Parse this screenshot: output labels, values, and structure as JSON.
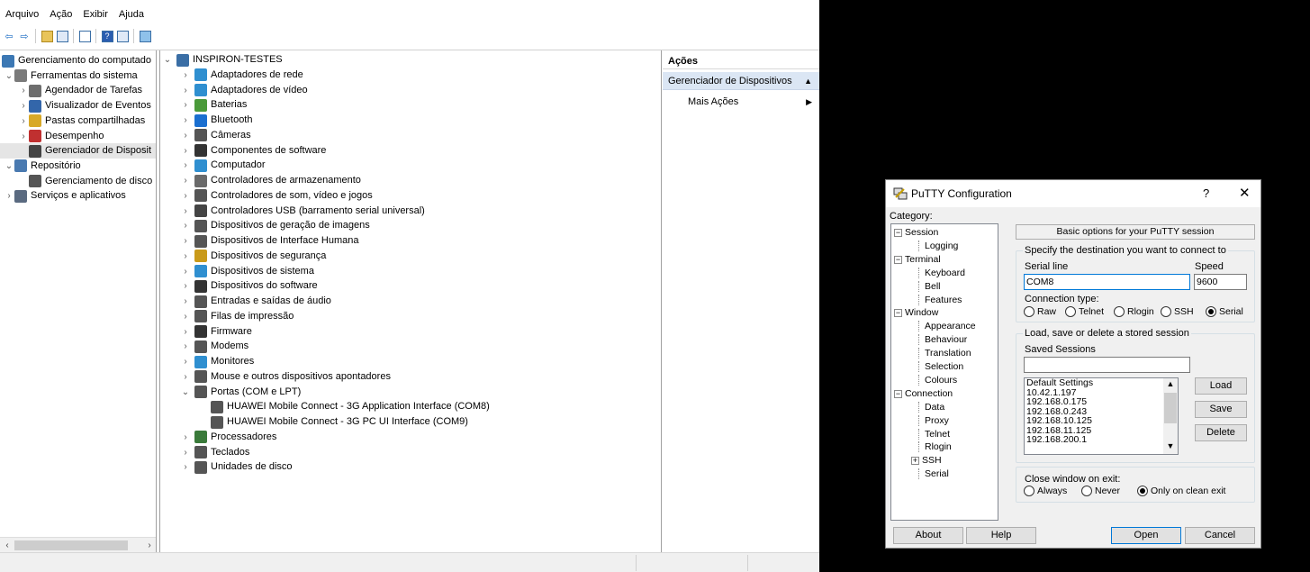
{
  "mmc": {
    "menu": [
      "Arquivo",
      "Ação",
      "Exibir",
      "Ajuda"
    ],
    "toolbar_icons": [
      "back-icon",
      "forward-icon",
      "folder-up-icon",
      "show-hide-tree-icon",
      "properties-icon",
      "help-icon",
      "action-pane-icon",
      "monitor-icon"
    ],
    "tree": [
      {
        "label": "Gerenciamento do computado",
        "indent": 0,
        "expander": "",
        "icon": "computer-management-icon",
        "color": "#3c78b4"
      },
      {
        "label": "Ferramentas do sistema",
        "indent": 1,
        "expander": "v",
        "icon": "tools-icon",
        "color": "#7a7a7a"
      },
      {
        "label": "Agendador de Tarefas",
        "indent": 2,
        "expander": ">",
        "icon": "clock-icon",
        "color": "#6e6e6e"
      },
      {
        "label": "Visualizador de Eventos",
        "indent": 2,
        "expander": ">",
        "icon": "event-viewer-icon",
        "color": "#3366aa"
      },
      {
        "label": "Pastas compartilhadas",
        "indent": 2,
        "expander": ">",
        "icon": "shared-folder-icon",
        "color": "#d8a928"
      },
      {
        "label": "Desempenho",
        "indent": 2,
        "expander": ">",
        "icon": "performance-icon",
        "color": "#c03030"
      },
      {
        "label": "Gerenciador de Disposit",
        "indent": 2,
        "expander": "",
        "icon": "device-manager-icon",
        "color": "#444444",
        "selected": true
      },
      {
        "label": "Repositório",
        "indent": 1,
        "expander": "v",
        "icon": "storage-icon",
        "color": "#4a7ab0"
      },
      {
        "label": "Gerenciamento de disco",
        "indent": 2,
        "expander": "",
        "icon": "disk-management-icon",
        "color": "#555555"
      },
      {
        "label": "Serviços e aplicativos",
        "indent": 1,
        "expander": ">",
        "icon": "services-icon",
        "color": "#5a6a80"
      }
    ],
    "devices": [
      {
        "label": "INSPIRON-TESTES",
        "level": 0,
        "expander": "v",
        "icon": "computer-icon",
        "color": "#3a6ea5"
      },
      {
        "label": "Adaptadores de rede",
        "level": 1,
        "expander": ">",
        "icon": "network-adapter-icon",
        "color": "#2f8fd0"
      },
      {
        "label": "Adaptadores de vídeo",
        "level": 1,
        "expander": ">",
        "icon": "display-adapter-icon",
        "color": "#2f8fd0"
      },
      {
        "label": "Baterias",
        "level": 1,
        "expander": ">",
        "icon": "battery-icon",
        "color": "#4a9a3a"
      },
      {
        "label": "Bluetooth",
        "level": 1,
        "expander": ">",
        "icon": "bluetooth-icon",
        "color": "#1a6fd0"
      },
      {
        "label": "Câmeras",
        "level": 1,
        "expander": ">",
        "icon": "camera-icon",
        "color": "#555555"
      },
      {
        "label": "Componentes de software",
        "level": 1,
        "expander": ">",
        "icon": "software-component-icon",
        "color": "#333333"
      },
      {
        "label": "Computador",
        "level": 1,
        "expander": ">",
        "icon": "monitor-icon",
        "color": "#2f8fd0"
      },
      {
        "label": "Controladores de armazenamento",
        "level": 1,
        "expander": ">",
        "icon": "storage-controller-icon",
        "color": "#6a6a6a"
      },
      {
        "label": "Controladores de som, vídeo e jogos",
        "level": 1,
        "expander": ">",
        "icon": "sound-icon",
        "color": "#555555"
      },
      {
        "label": "Controladores USB (barramento serial universal)",
        "level": 1,
        "expander": ">",
        "icon": "usb-icon",
        "color": "#444444"
      },
      {
        "label": "Dispositivos de geração de imagens",
        "level": 1,
        "expander": ">",
        "icon": "imaging-icon",
        "color": "#555555"
      },
      {
        "label": "Dispositivos de Interface Humana",
        "level": 1,
        "expander": ">",
        "icon": "hid-icon",
        "color": "#555555"
      },
      {
        "label": "Dispositivos de segurança",
        "level": 1,
        "expander": ">",
        "icon": "security-device-icon",
        "color": "#c99a1a"
      },
      {
        "label": "Dispositivos de sistema",
        "level": 1,
        "expander": ">",
        "icon": "system-device-icon",
        "color": "#2f8fd0"
      },
      {
        "label": "Dispositivos do software",
        "level": 1,
        "expander": ">",
        "icon": "software-device-icon",
        "color": "#333333"
      },
      {
        "label": "Entradas e saídas de áudio",
        "level": 1,
        "expander": ">",
        "icon": "audio-io-icon",
        "color": "#555555"
      },
      {
        "label": "Filas de impressão",
        "level": 1,
        "expander": ">",
        "icon": "printer-icon",
        "color": "#555555"
      },
      {
        "label": "Firmware",
        "level": 1,
        "expander": ">",
        "icon": "firmware-icon",
        "color": "#333333"
      },
      {
        "label": "Modems",
        "level": 1,
        "expander": ">",
        "icon": "modem-icon",
        "color": "#555555"
      },
      {
        "label": "Monitores",
        "level": 1,
        "expander": ">",
        "icon": "monitor-icon",
        "color": "#2f8fd0"
      },
      {
        "label": "Mouse e outros dispositivos apontadores",
        "level": 1,
        "expander": ">",
        "icon": "mouse-icon",
        "color": "#555555"
      },
      {
        "label": "Portas (COM e LPT)",
        "level": 1,
        "expander": "v",
        "icon": "port-icon",
        "color": "#555555"
      },
      {
        "label": "HUAWEI Mobile Connect - 3G Application Interface (COM8)",
        "level": 2,
        "expander": "",
        "icon": "port-icon",
        "color": "#555555"
      },
      {
        "label": "HUAWEI Mobile Connect - 3G PC UI Interface (COM9)",
        "level": 2,
        "expander": "",
        "icon": "port-icon",
        "color": "#555555"
      },
      {
        "label": "Processadores",
        "level": 1,
        "expander": ">",
        "icon": "processor-icon",
        "color": "#3a7a3a"
      },
      {
        "label": "Teclados",
        "level": 1,
        "expander": ">",
        "icon": "keyboard-icon",
        "color": "#555555"
      },
      {
        "label": "Unidades de disco",
        "level": 1,
        "expander": ">",
        "icon": "disk-drive-icon",
        "color": "#555555"
      }
    ],
    "actions": {
      "header": "Ações",
      "selected": "Gerenciador de Dispositivos",
      "more": "Mais Ações"
    }
  },
  "putty": {
    "title": "PuTTY Configuration",
    "help_glyph": "?",
    "close_glyph": "✕",
    "category_label": "Category:",
    "categories": [
      {
        "label": "Session",
        "kind": "group"
      },
      {
        "label": "Logging",
        "kind": "leaf"
      },
      {
        "label": "Terminal",
        "kind": "group"
      },
      {
        "label": "Keyboard",
        "kind": "leaf"
      },
      {
        "label": "Bell",
        "kind": "leaf"
      },
      {
        "label": "Features",
        "kind": "leaf"
      },
      {
        "label": "Window",
        "kind": "group"
      },
      {
        "label": "Appearance",
        "kind": "leaf"
      },
      {
        "label": "Behaviour",
        "kind": "leaf"
      },
      {
        "label": "Translation",
        "kind": "leaf"
      },
      {
        "label": "Selection",
        "kind": "leaf"
      },
      {
        "label": "Colours",
        "kind": "leaf"
      },
      {
        "label": "Connection",
        "kind": "group"
      },
      {
        "label": "Data",
        "kind": "leaf"
      },
      {
        "label": "Proxy",
        "kind": "leaf"
      },
      {
        "label": "Telnet",
        "kind": "leaf"
      },
      {
        "label": "Rlogin",
        "kind": "leaf"
      },
      {
        "label": "SSH",
        "kind": "plusleaf"
      },
      {
        "label": "Serial",
        "kind": "leaf"
      }
    ],
    "header": "Basic options for your PuTTY session",
    "dest_label": "Specify the destination you want to connect to",
    "serial_line_label": "Serial line",
    "serial_line_value": "COM8",
    "speed_label": "Speed",
    "speed_value": "9600",
    "conn_type_label": "Connection type:",
    "conn_types": [
      "Raw",
      "Telnet",
      "Rlogin",
      "SSH",
      "Serial"
    ],
    "conn_selected": "Serial",
    "sessions_group_label": "Load, save or delete a stored session",
    "saved_sessions_label": "Saved Sessions",
    "saved_sessions_value": "",
    "sessions": [
      "Default Settings",
      "10.42.1.197",
      "192.168.0.175",
      "192.168.0.243",
      "192.168.10.125",
      "192.168.11.125",
      "192.168.200.1"
    ],
    "load": "Load",
    "save": "Save",
    "delete": "Delete",
    "close_exit_label": "Close window on exit:",
    "close_options": [
      "Always",
      "Never",
      "Only on clean exit"
    ],
    "close_selected": "Only on clean exit",
    "about": "About",
    "help": "Help",
    "open": "Open",
    "cancel": "Cancel"
  }
}
